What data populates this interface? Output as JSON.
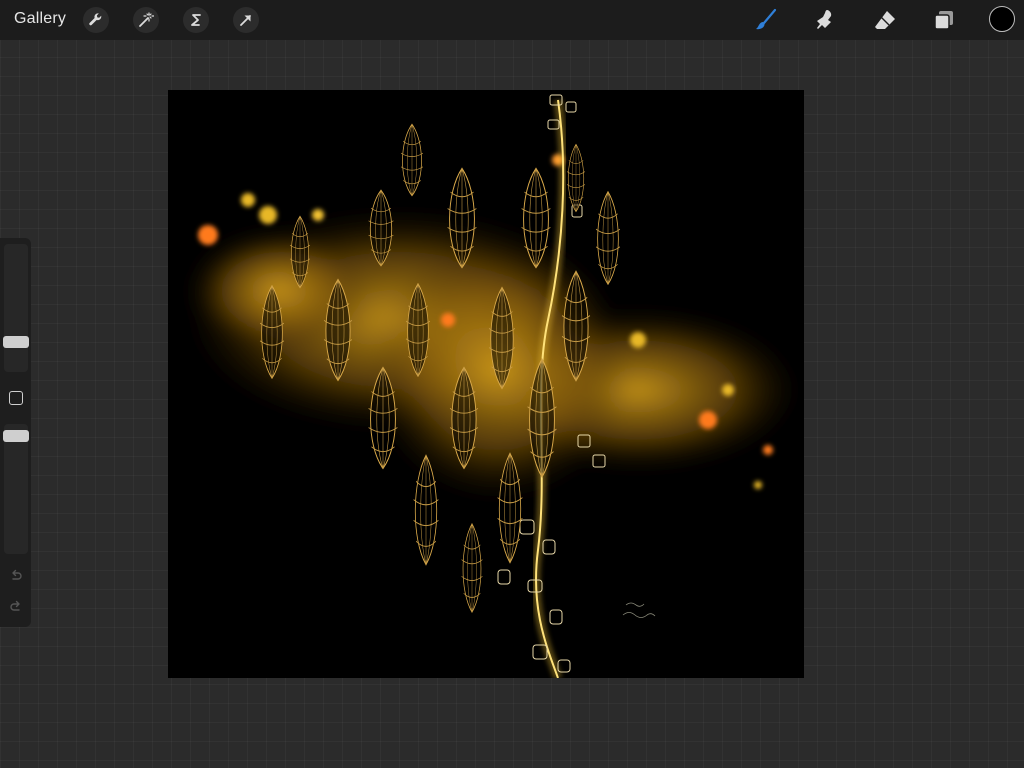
{
  "topbar": {
    "gallery_label": "Gallery",
    "left_tools": [
      "wrench-icon",
      "magic-wand-icon",
      "selection-icon",
      "transform-arrow-icon"
    ],
    "right_tools": [
      "brush-icon",
      "smudge-icon",
      "eraser-icon",
      "layers-icon"
    ],
    "active_tool": "brush-icon",
    "current_color": "#000000",
    "accent_color": "#2f7fd8"
  },
  "sidebar": {
    "controls": [
      "brush-size-slider",
      "modify-button",
      "opacity-slider",
      "undo-icon",
      "redo-icon"
    ]
  },
  "canvas": {
    "background": "#000000",
    "artwork_colors": [
      "#c8961e",
      "#e8b828",
      "#ff7a1e",
      "#f4e27a"
    ]
  }
}
